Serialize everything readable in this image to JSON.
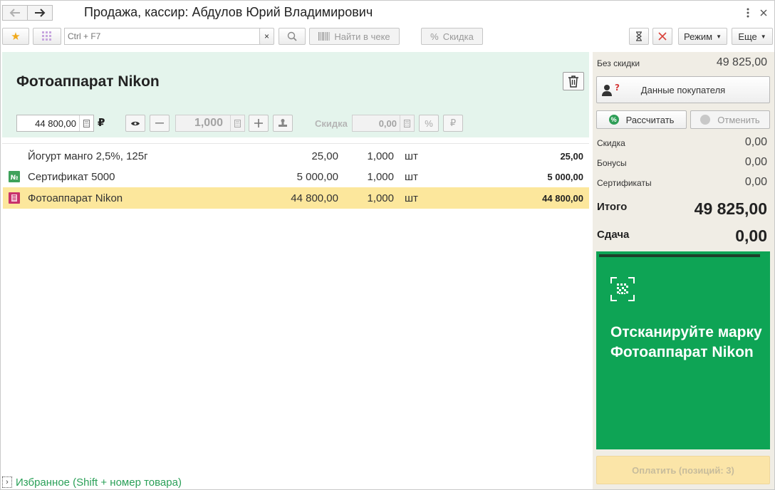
{
  "window": {
    "title": "Продажа, кассир: Абдулов Юрий Владимирович",
    "back_icon": "arrow-left-icon",
    "forward_icon": "arrow-right-icon"
  },
  "toolbar": {
    "search_placeholder": "Ctrl + F7",
    "clear_label": "×",
    "find_in_receipt_label": "Найти в чеке",
    "discount_label": "Скидка",
    "mode_label": "Режим",
    "more_label": "Еще"
  },
  "product": {
    "name": "Фотоаппарат Nikon",
    "price": "44 800,00",
    "currency": "₽",
    "quantity": "1,000",
    "discount_label": "Скидка",
    "discount_value": "0,00"
  },
  "items": [
    {
      "icon": "none",
      "name": "Йогурт манго 2,5%, 125г",
      "price": "25,00",
      "qty": "1,000",
      "unit": "шт",
      "sum": "25,00",
      "selected": false
    },
    {
      "icon": "certificate-icon",
      "name": "Сертификат 5000",
      "price": "5 000,00",
      "qty": "1,000",
      "unit": "шт",
      "sum": "5 000,00",
      "selected": false
    },
    {
      "icon": "marked-goods-icon",
      "name": "Фотоаппарат Nikon",
      "price": "44 800,00",
      "qty": "1,000",
      "unit": "шт",
      "sum": "44 800,00",
      "selected": true
    }
  ],
  "favorites_label": "Избранное (Shift + номер товара)",
  "summary": {
    "no_discount_label": "Без скидки",
    "no_discount_value": "49 825,00",
    "customer_data_label": "Данные покупателя",
    "calculate_label": "Рассчитать",
    "cancel_label": "Отменить",
    "discount_label": "Скидка",
    "discount_value": "0,00",
    "bonus_label": "Бонусы",
    "bonus_value": "0,00",
    "certificates_label": "Сертификаты",
    "certificates_value": "0,00",
    "total_label": "Итого",
    "total_value": "49 825,00",
    "change_label": "Сдача",
    "change_value": "0,00"
  },
  "scan_prompt": "Отсканируйте марку Фотоаппарат Nikon",
  "pay_label": "Оплатить (позиций: 3)",
  "colors": {
    "product_panel_bg": "#e4f4ec",
    "selected_row_bg": "#fce79c",
    "scan_panel_bg": "#0ea455",
    "right_panel_bg": "#f0ede5",
    "favorites_link": "#2aa058"
  }
}
